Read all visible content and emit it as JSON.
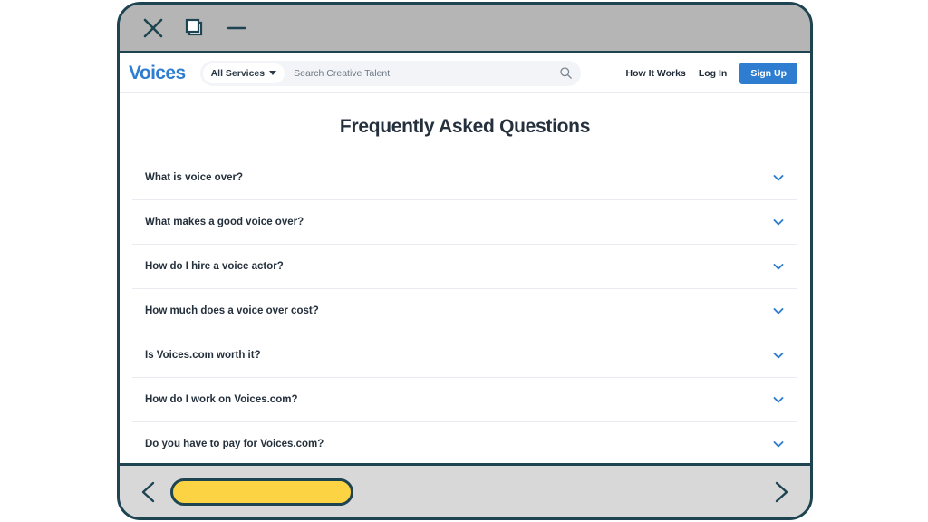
{
  "window": {
    "controls": [
      {
        "name": "close",
        "icon": "close-icon"
      },
      {
        "name": "restore",
        "icon": "restore-window-icon"
      },
      {
        "name": "minimize",
        "icon": "minimize-icon"
      }
    ]
  },
  "site_header": {
    "logo": "Voices",
    "search": {
      "category_label": "All Services",
      "placeholder": "Search Creative Talent",
      "value": "",
      "search_icon": "search-icon",
      "caret_icon": "chevron-down-icon"
    },
    "nav": [
      {
        "label": "How It Works"
      },
      {
        "label": "Log In"
      }
    ],
    "signup_label": "Sign Up"
  },
  "main": {
    "title": "Frequently Asked Questions",
    "faq": [
      {
        "question": "What is voice over?",
        "icon": "chevron-down-icon"
      },
      {
        "question": "What makes a good voice over?",
        "icon": "chevron-down-icon"
      },
      {
        "question": "How do I hire a voice actor?",
        "icon": "chevron-down-icon"
      },
      {
        "question": "How much does a voice over cost?",
        "icon": "chevron-down-icon"
      },
      {
        "question": "Is Voices.com worth it?",
        "icon": "chevron-down-icon"
      },
      {
        "question": "How do I work on Voices.com?",
        "icon": "chevron-down-icon"
      },
      {
        "question": "Do you have to pay for Voices.com?",
        "icon": "chevron-down-icon"
      }
    ]
  },
  "bottom_bar": {
    "back_icon": "chevron-left-icon",
    "forward_icon": "chevron-right-icon",
    "scrollbar_name": "horizontal-scrollbar"
  },
  "colors": {
    "brand_blue": "#2e7dd1",
    "frame_teal": "#1d4450",
    "scroll_yellow": "#fcd343",
    "titlebar_gray": "#b5b5b5",
    "bottombar_gray": "#d8d8d8",
    "text_dark": "#25303d"
  }
}
